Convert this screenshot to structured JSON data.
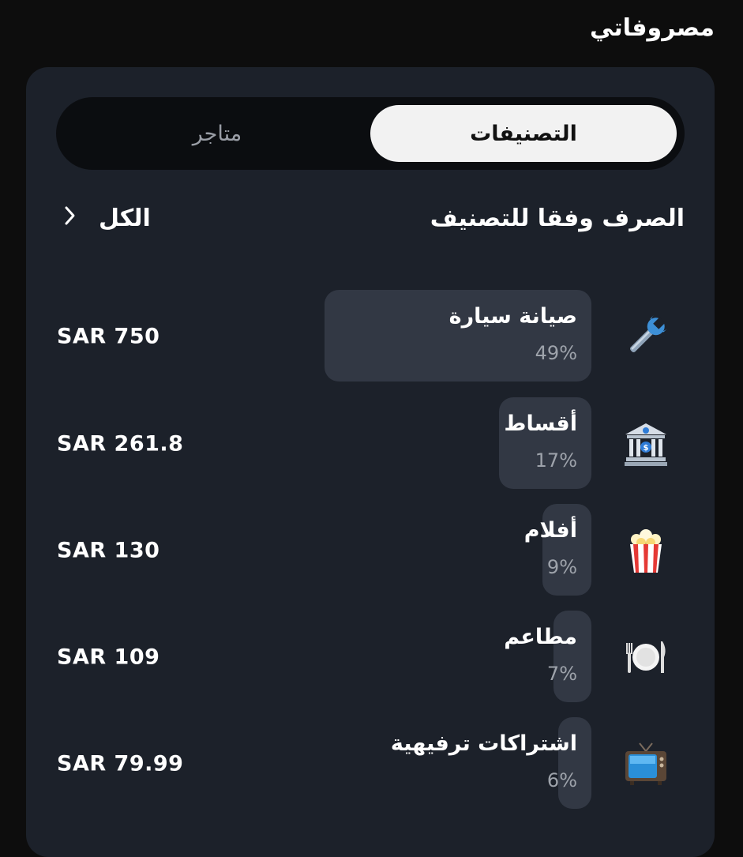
{
  "page": {
    "title": "مصروفاتي"
  },
  "tabs": {
    "categories": "التصنيفات",
    "stores": "متاجر"
  },
  "section": {
    "title": "الصرف وفقا للتصنيف",
    "see_all": "الكل"
  },
  "categories": [
    {
      "name": "صيانة سيارة",
      "percent": "49%",
      "share": 49,
      "amount": "SAR 750",
      "icon": "wrench-icon"
    },
    {
      "name": "أقساط",
      "percent": "17%",
      "share": 17,
      "amount": "SAR 261.8",
      "icon": "bank-icon"
    },
    {
      "name": "أفلام",
      "percent": "9%",
      "share": 9,
      "amount": "SAR 130",
      "icon": "popcorn-icon"
    },
    {
      "name": "مطاعم",
      "percent": "7%",
      "share": 7,
      "amount": "SAR 109",
      "icon": "plate-cutlery-icon"
    },
    {
      "name": "اشتراكات ترفيهية",
      "percent": "6%",
      "share": 6,
      "amount": "SAR 79.99",
      "icon": "tv-icon"
    }
  ]
}
